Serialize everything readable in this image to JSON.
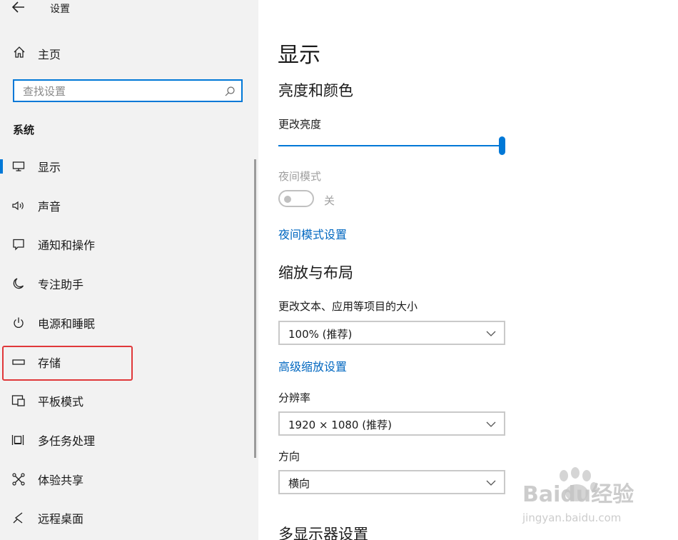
{
  "window": {
    "title": "设置"
  },
  "sidebar": {
    "home_label": "主页",
    "search_placeholder": "查找设置",
    "section": "系统",
    "items": [
      {
        "label": "显示",
        "icon": "monitor-icon",
        "selected": true
      },
      {
        "label": "声音",
        "icon": "speaker-icon"
      },
      {
        "label": "通知和操作",
        "icon": "notification-icon"
      },
      {
        "label": "专注助手",
        "icon": "moon-icon"
      },
      {
        "label": "电源和睡眠",
        "icon": "power-icon"
      },
      {
        "label": "存储",
        "icon": "storage-icon",
        "highlighted": true
      },
      {
        "label": "平板模式",
        "icon": "tablet-mode-icon"
      },
      {
        "label": "多任务处理",
        "icon": "multitasking-icon"
      },
      {
        "label": "体验共享",
        "icon": "shared-experience-icon"
      },
      {
        "label": "远程桌面",
        "icon": "remote-desktop-icon"
      }
    ]
  },
  "main": {
    "title": "显示",
    "brightness": {
      "heading": "亮度和颜色",
      "label": "更改亮度",
      "value_fraction": 1.0
    },
    "night_light": {
      "label": "夜间模式",
      "state": "关",
      "link": "夜间模式设置"
    },
    "scale": {
      "heading": "缩放与布局",
      "label": "更改文本、应用等项目的大小",
      "value": "100% (推荐)",
      "advanced_link": "高级缩放设置"
    },
    "resolution": {
      "label": "分辨率",
      "value": "1920 × 1080 (推荐)"
    },
    "orientation": {
      "label": "方向",
      "value": "横向"
    },
    "multi_display": {
      "heading": "多显示器设置"
    }
  },
  "watermark": {
    "brand": "Baidu经验",
    "url": "jingyan.baidu.com"
  },
  "colors": {
    "accent": "#0078d7",
    "link": "#0067c0",
    "highlight_box": "#e0383a",
    "sidebar_bg": "#f2f2f2"
  }
}
